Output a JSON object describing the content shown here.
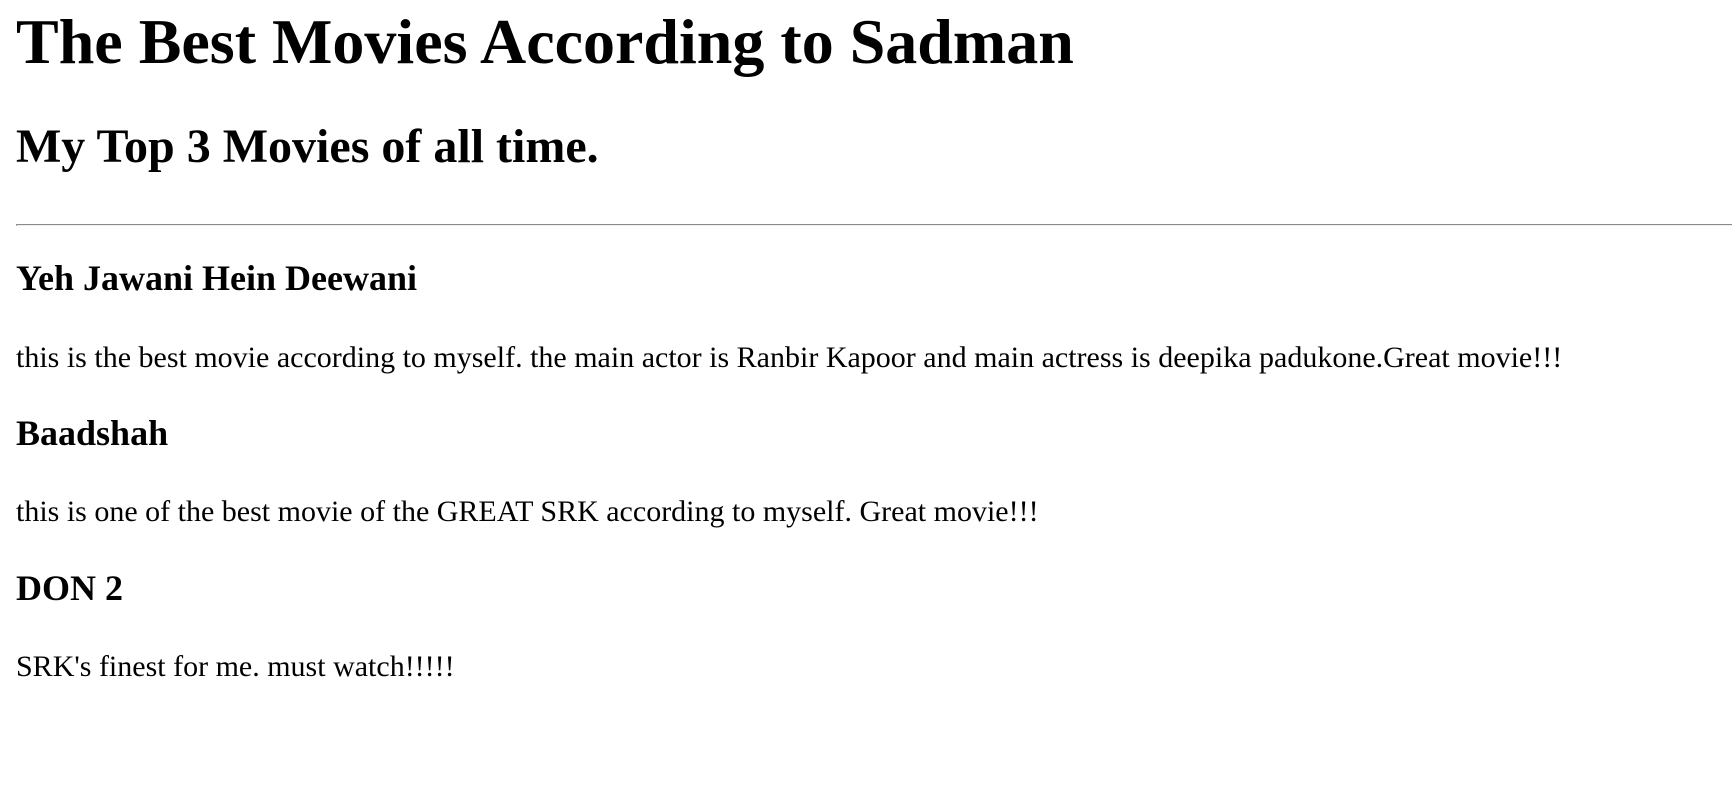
{
  "page": {
    "title": "The Best Movies According to Sadman",
    "subtitle": "My Top 3 Movies of all time."
  },
  "movies": [
    {
      "title": "Yeh Jawani Hein Deewani",
      "description": "this is the best movie according to myself. the main actor is Ranbir Kapoor and main actress is deepika padukone.Great movie!!!"
    },
    {
      "title": "Baadshah",
      "description": "this is one of the best movie of the GREAT SRK according to myself. Great movie!!!"
    },
    {
      "title": "DON 2",
      "description": "SRK's finest for me. must watch!!!!!"
    }
  ]
}
